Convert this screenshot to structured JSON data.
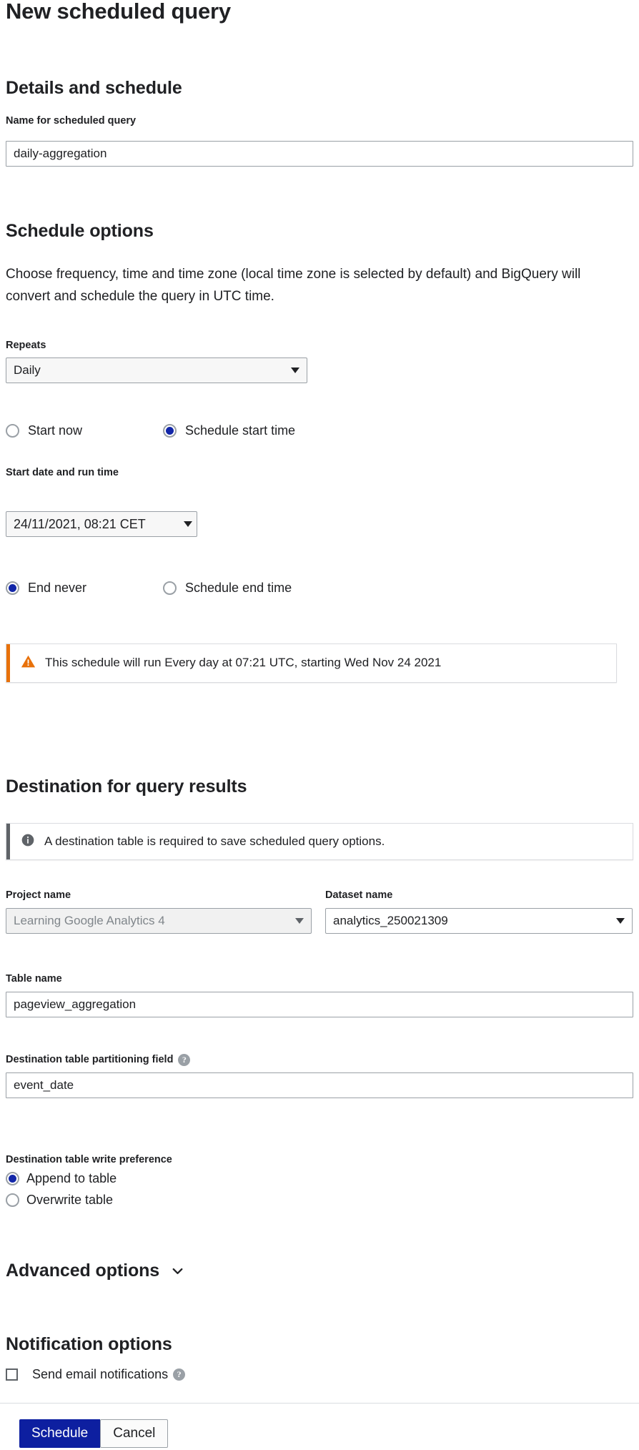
{
  "page": {
    "title": "New scheduled query"
  },
  "details": {
    "section_title": "Details and schedule",
    "name_label": "Name for scheduled query",
    "name_value": "daily-aggregation",
    "name_placeholder": "Name for scheduled query"
  },
  "schedule": {
    "section_title": "Schedule options",
    "description": "Choose frequency, time and time zone (local time zone is selected by default) and BigQuery will convert and schedule the query in UTC time.",
    "repeats_label": "Repeats",
    "repeats_value": "Daily",
    "start_now_label": "Start now",
    "schedule_start_time_label": "Schedule start time",
    "start_date_label": "Start date and run time",
    "start_date_value": "24/11/2021, 08:21 CET",
    "end_never_label": "End never",
    "schedule_end_time_label": "Schedule end time",
    "warning_text": "This schedule will run Every day at 07:21 UTC, starting Wed Nov 24 2021",
    "warning_icon": "warning-triangle-icon"
  },
  "destination": {
    "section_title": "Destination for query results",
    "info_text": "A destination table is required to save scheduled query options.",
    "info_icon": "info-circle-icon",
    "project_label": "Project name",
    "project_value": "Learning Google Analytics 4",
    "dataset_label": "Dataset name",
    "dataset_value": "analytics_250021309",
    "table_label": "Table name",
    "table_value": "pageview_aggregation",
    "partition_label": "Destination table partitioning field",
    "partition_help_icon": "help-circle-icon",
    "partition_value": "event_date",
    "write_pref_label": "Destination table write preference",
    "append_label": "Append to table",
    "overwrite_label": "Overwrite table"
  },
  "advanced": {
    "title": "Advanced options",
    "expand_icon": "chevron-down-icon"
  },
  "notification": {
    "section_title": "Notification options",
    "send_email_label": "Send email notifications",
    "help_icon": "help-circle-icon"
  },
  "footer": {
    "submit_label": "Schedule",
    "cancel_label": "Cancel"
  },
  "colors": {
    "primary": "#0d1fa0",
    "radio_selected": "#1226a8",
    "warning_accent": "#e8710a",
    "info_accent": "#5f6368"
  }
}
